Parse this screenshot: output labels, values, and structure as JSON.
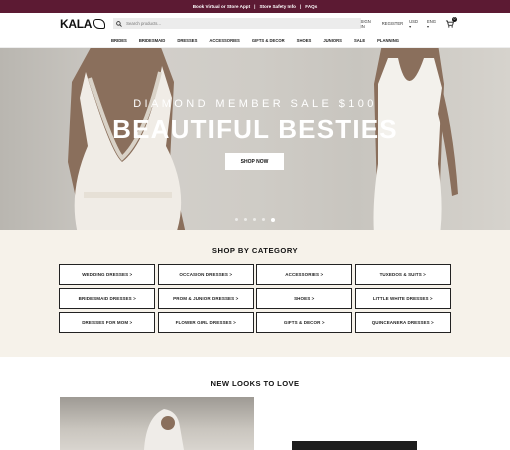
{
  "topbar": {
    "link1": "Book Virtual or Store Appt",
    "sep": "|",
    "link2": "Store Safety Info",
    "link3": "FAQs",
    "bg_color": "#5c1a33"
  },
  "header": {
    "logo": "KALA",
    "search_placeholder": "Search products...",
    "sign_in": "SIGN IN",
    "register": "REGISTER",
    "currency": "USD ▾",
    "language": "ENG ▾",
    "cart_count": "0"
  },
  "nav": {
    "items": [
      "BRIDES",
      "BRIDESMAID",
      "DRESSES",
      "ACCESSORIES",
      "GIFTS & DECOR",
      "SHOES",
      "JUNIORS",
      "SALE",
      "PLANNING"
    ]
  },
  "hero": {
    "subtitle": "DIAMOND MEMBER SALE $100",
    "title": "BEAUTIFUL BESTIES",
    "button": "SHOP NOW",
    "slide_count": 5,
    "active_slide": 5
  },
  "categories": {
    "heading": "SHOP BY CATEGORY",
    "items": [
      "WEDDING DRESSES >",
      "OCCASION DRESSES >",
      "ACCESSORIES >",
      "TUXEDOS & SUITS >",
      "BRIDESMAID DRESSES >",
      "PROM & JUNIOR DRESSES >",
      "SHOES >",
      "LITTLE WHITE DRESSES >",
      "DRESSES FOR MOM >",
      "FLOWER GIRL DRESSES >",
      "GIFTS & DECOR >",
      "QUINCEANERA DRESSES >"
    ],
    "bg_color": "#f6f2ea"
  },
  "looks": {
    "heading": "NEW LOOKS TO LOVE"
  }
}
